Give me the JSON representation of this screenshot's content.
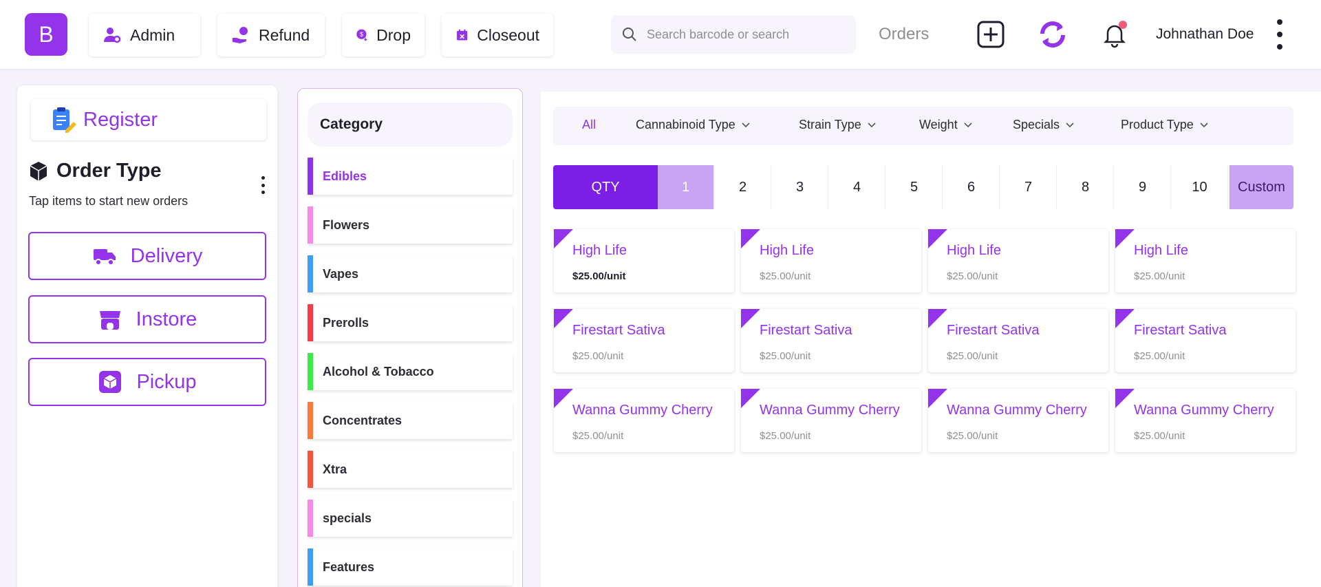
{
  "header": {
    "logo_letter": "B",
    "nav": [
      {
        "label": "Admin",
        "icon": "admin-user-gear-icon"
      },
      {
        "label": "Refund",
        "icon": "refund-hand-coin-icon"
      },
      {
        "label": "Drop",
        "icon": "dollar-drop-icon"
      },
      {
        "label": "Closeout",
        "icon": "calendar-x-icon"
      }
    ],
    "search_placeholder": "Search barcode or search",
    "orders_label": "Orders",
    "user_name": "Johnathan Doe",
    "accent_color": "#9333ea"
  },
  "left_panel": {
    "register_label": "Register",
    "order_type_title": "Order Type",
    "order_type_subtitle": "Tap items to start new orders",
    "order_types": [
      "Delivery",
      "Instore",
      "Pickup"
    ]
  },
  "categories": {
    "header": "Category",
    "items": [
      {
        "label": "Edibles",
        "color": "#8b35ef",
        "active": true
      },
      {
        "label": "Flowers",
        "color": "#f48ae7"
      },
      {
        "label": "Vapes",
        "color": "#3ba0f4"
      },
      {
        "label": "Prerolls",
        "color": "#f23b4b"
      },
      {
        "label": "Alcohol & Tobacco",
        "color": "#3ce84a"
      },
      {
        "label": "Concentrates",
        "color": "#f57b3a"
      },
      {
        "label": "Xtra",
        "color": "#f6553d"
      },
      {
        "label": "specials",
        "color": "#f48ae7"
      },
      {
        "label": "Features",
        "color": "#3ba0f4"
      }
    ]
  },
  "filters": {
    "all_label": "All",
    "items": [
      "Cannabinoid Type",
      "Strain Type",
      "Weight",
      "Specials",
      "Product Type"
    ]
  },
  "qty": {
    "label": "QTY",
    "options": [
      "1",
      "2",
      "3",
      "4",
      "5",
      "6",
      "7",
      "8",
      "9",
      "10"
    ],
    "selected": "1",
    "custom_label": "Custom"
  },
  "products": [
    {
      "name": "High Life",
      "price": "$25.00/unit"
    },
    {
      "name": "High Life",
      "price": "$25.00/unit"
    },
    {
      "name": "High Life",
      "price": "$25.00/unit"
    },
    {
      "name": "High Life",
      "price": "$25.00/unit"
    },
    {
      "name": "Firestart Sativa",
      "price": "$25.00/unit"
    },
    {
      "name": "Firestart Sativa",
      "price": "$25.00/unit"
    },
    {
      "name": "Firestart Sativa",
      "price": "$25.00/unit"
    },
    {
      "name": "Firestart Sativa",
      "price": "$25.00/unit"
    },
    {
      "name": "Wanna Gummy Cherry",
      "price": "$25.00/unit"
    },
    {
      "name": "Wanna Gummy Cherry",
      "price": "$25.00/unit"
    },
    {
      "name": "Wanna Gummy Cherry",
      "price": "$25.00/unit"
    },
    {
      "name": "Wanna Gummy Cherry",
      "price": "$25.00/unit"
    }
  ]
}
